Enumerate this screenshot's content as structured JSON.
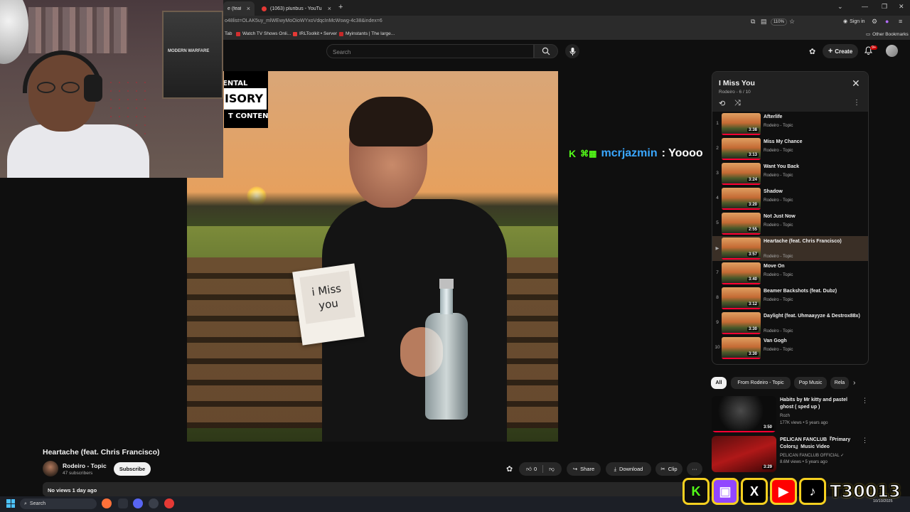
{
  "browser": {
    "tabs": [
      {
        "label": "e (feat. Chr",
        "close": "×"
      },
      {
        "label": "(1063) pluribus - YouTube",
        "close": "×"
      }
    ],
    "new_tab": "+",
    "window_controls": [
      "⌄",
      "—",
      "❐",
      "✕"
    ],
    "url": "o48list=OLAK5uy_mlWEwyMoOioWYxoVdqcInMcWswg-4c38&index=6",
    "zoom": "110%",
    "sign_in": "Sign in",
    "bookmarks": [
      "Tab",
      "Watch TV Shows Onli...",
      "IRLToolkit • Server",
      "Myinstants | The large..."
    ],
    "other_bookmarks": "Other Bookmarks"
  },
  "header": {
    "search_placeholder": "Search",
    "create_label": "Create",
    "notifications_badge": "9+"
  },
  "player": {
    "advisory_lines": [
      "ENTAL",
      "ISORY",
      "T CONTENT"
    ],
    "card_text": "i Miss you"
  },
  "chat": {
    "platform_badge": "K",
    "badges": "⌘▦",
    "username": "mcrjazmin",
    "separator": ":",
    "message": "Yoooo"
  },
  "video": {
    "title": "Heartache (feat. Chris Francisco)",
    "channel": "Rodeiro - Topic",
    "subscribers": "47 subscribers",
    "subscribe_label": "Subscribe",
    "likes": "0",
    "share_label": "Share",
    "download_label": "Download",
    "clip_label": "Clip",
    "more_label": "···",
    "description_meta": "No views  1 day ago"
  },
  "playlist": {
    "title": "I Miss You",
    "subtitle": "Rodeiro - 6 / 10",
    "items": [
      {
        "num": "1",
        "title": "Afterlife",
        "artist": "Rodeiro - Topic",
        "duration": "3:38"
      },
      {
        "num": "2",
        "title": "Miss My Chance",
        "artist": "Rodeiro - Topic",
        "duration": "3:13"
      },
      {
        "num": "3",
        "title": "Want You Back",
        "artist": "Rodeiro - Topic",
        "duration": "3:24"
      },
      {
        "num": "4",
        "title": "Shadow",
        "artist": "Rodeiro - Topic",
        "duration": "3:20"
      },
      {
        "num": "5",
        "title": "Not Just Now",
        "artist": "Rodeiro - Topic",
        "duration": "2:55"
      },
      {
        "num": "▶",
        "title": "Heartache (feat. Chris Francisco)",
        "artist": "Rodeiro - Topic",
        "duration": "3:57"
      },
      {
        "num": "7",
        "title": "Move On",
        "artist": "Rodeiro - Topic",
        "duration": "3:40"
      },
      {
        "num": "8",
        "title": "Beamer Backshots (feat. Dubz)",
        "artist": "Rodeiro - Topic",
        "duration": "3:12"
      },
      {
        "num": "9",
        "title": "Daylight (feat. Uhmaayyze & Destrox88x)",
        "artist": "Rodeiro - Topic",
        "duration": "3:30"
      },
      {
        "num": "10",
        "title": "Van Gogh",
        "artist": "Rodeiro - Topic",
        "duration": "3:30"
      }
    ]
  },
  "chips": [
    "All",
    "From Rodeiro - Topic",
    "Pop Music",
    "Rela"
  ],
  "recommendations": [
    {
      "title": "Habits by Mr kitty and pastel ghost ( sped up )",
      "channel": "Rozh",
      "meta": "177K views • 5 years ago",
      "duration": "3:50"
    },
    {
      "title": "PELICAN FANCLUB『Primary Colors』Music Video",
      "channel": "PELICAN FANCLUB OFFICIAL ✓",
      "meta": "8.6M views • 5 years ago",
      "duration": "3:29"
    }
  ],
  "taskbar": {
    "search_label": "Search",
    "clock_time": "",
    "clock_date": "10/10/2025"
  },
  "webcam": {
    "poster_text": "MODERN WARFARE"
  },
  "social": {
    "icons": [
      "K",
      "▣",
      "X",
      "▶",
      "♪"
    ],
    "handle": "T30013"
  },
  "colors": {
    "accent": "#ff0033",
    "kick_green": "#53fc18",
    "chat_user": "#3aa7ff",
    "social_border": "#f5d020"
  }
}
